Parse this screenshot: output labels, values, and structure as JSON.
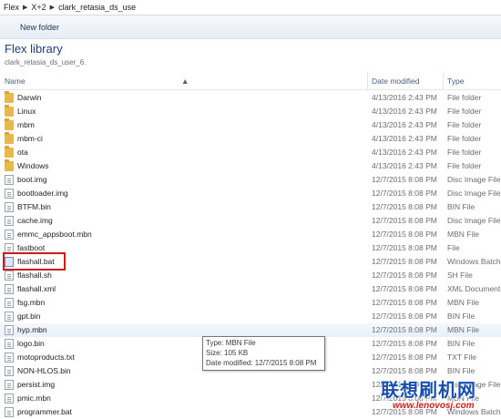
{
  "address": {
    "crumbs": [
      "Flex",
      "X+2",
      "clark_retasia_ds_use"
    ]
  },
  "toolbar": {
    "new_folder": "New folder"
  },
  "library": {
    "title": "Flex library",
    "subtitle": "clark_retasia_ds_user_6."
  },
  "columns": {
    "name": "Name",
    "date": "Date modified",
    "type": "Type"
  },
  "files": [
    {
      "icon": "folder-icon",
      "name": "Darwin",
      "date": "4/13/2016 2:43 PM",
      "type": "File folder"
    },
    {
      "icon": "folder-icon",
      "name": "Linux",
      "date": "4/13/2016 2:43 PM",
      "type": "File folder"
    },
    {
      "icon": "folder-icon",
      "name": "mbm",
      "date": "4/13/2016 2:43 PM",
      "type": "File folder"
    },
    {
      "icon": "folder-icon",
      "name": "mbm-ci",
      "date": "4/13/2016 2:43 PM",
      "type": "File folder"
    },
    {
      "icon": "folder-icon",
      "name": "ota",
      "date": "4/13/2016 2:43 PM",
      "type": "File folder"
    },
    {
      "icon": "folder-icon",
      "name": "Windows",
      "date": "4/13/2016 2:43 PM",
      "type": "File folder"
    },
    {
      "icon": "file-icon",
      "name": "boot.img",
      "date": "12/7/2015 8:08 PM",
      "type": "Disc Image File"
    },
    {
      "icon": "file-icon",
      "name": "bootloader.img",
      "date": "12/7/2015 8:08 PM",
      "type": "Disc Image File"
    },
    {
      "icon": "file-icon",
      "name": "BTFM.bin",
      "date": "12/7/2015 8:08 PM",
      "type": "BIN File"
    },
    {
      "icon": "file-icon",
      "name": "cache.img",
      "date": "12/7/2015 8:08 PM",
      "type": "Disc Image File"
    },
    {
      "icon": "file-icon",
      "name": "emmc_appsboot.mbn",
      "date": "12/7/2015 8:08 PM",
      "type": "MBN File"
    },
    {
      "icon": "file-icon",
      "name": "fastboot",
      "date": "12/7/2015 8:08 PM",
      "type": "File"
    },
    {
      "icon": "bat-icon",
      "name": "flashall.bat",
      "date": "12/7/2015 8:08 PM",
      "type": "Windows Batch",
      "highlight": true
    },
    {
      "icon": "file-icon",
      "name": "flashall.sh",
      "date": "12/7/2015 8:08 PM",
      "type": "SH File"
    },
    {
      "icon": "file-icon",
      "name": "flashall.xml",
      "date": "12/7/2015 8:08 PM",
      "type": "XML Document"
    },
    {
      "icon": "file-icon",
      "name": "fsg.mbn",
      "date": "12/7/2015 8:08 PM",
      "type": "MBN File"
    },
    {
      "icon": "file-icon",
      "name": "gpt.bin",
      "date": "12/7/2015 8:08 PM",
      "type": "BIN File"
    },
    {
      "icon": "file-icon",
      "name": "hyp.mbn",
      "date": "12/7/2015 8:08 PM",
      "type": "MBN File",
      "hover": true
    },
    {
      "icon": "file-icon",
      "name": "logo.bin",
      "date": "12/7/2015 8:08 PM",
      "type": "BIN File"
    },
    {
      "icon": "file-icon",
      "name": "motoproducts.txt",
      "date": "12/7/2015 8:08 PM",
      "type": "TXT File"
    },
    {
      "icon": "file-icon",
      "name": "NON-HLOS.bin",
      "date": "12/7/2015 8:08 PM",
      "type": "BIN File"
    },
    {
      "icon": "file-icon",
      "name": "persist.img",
      "date": "12/7/2015 8:08 PM",
      "type": "Disc Image File"
    },
    {
      "icon": "file-icon",
      "name": "pmic.mbn",
      "date": "12/7/2015 8:08 PM",
      "type": "MBN File"
    },
    {
      "icon": "file-icon",
      "name": "programmer.bat",
      "date": "12/7/2015 8:08 PM",
      "type": "Windows Batch"
    }
  ],
  "tooltip": {
    "line1": "Type: MBN File",
    "line2": "Size: 105 KB",
    "line3": "Date modified: 12/7/2015 8:08 PM"
  },
  "watermark": {
    "text": "联想刷机网",
    "url": "www.lenovosj.com"
  },
  "colors": {
    "highlight_box": "#d11b1b",
    "folder": "#e7b94a",
    "title": "#1e3d7a"
  }
}
